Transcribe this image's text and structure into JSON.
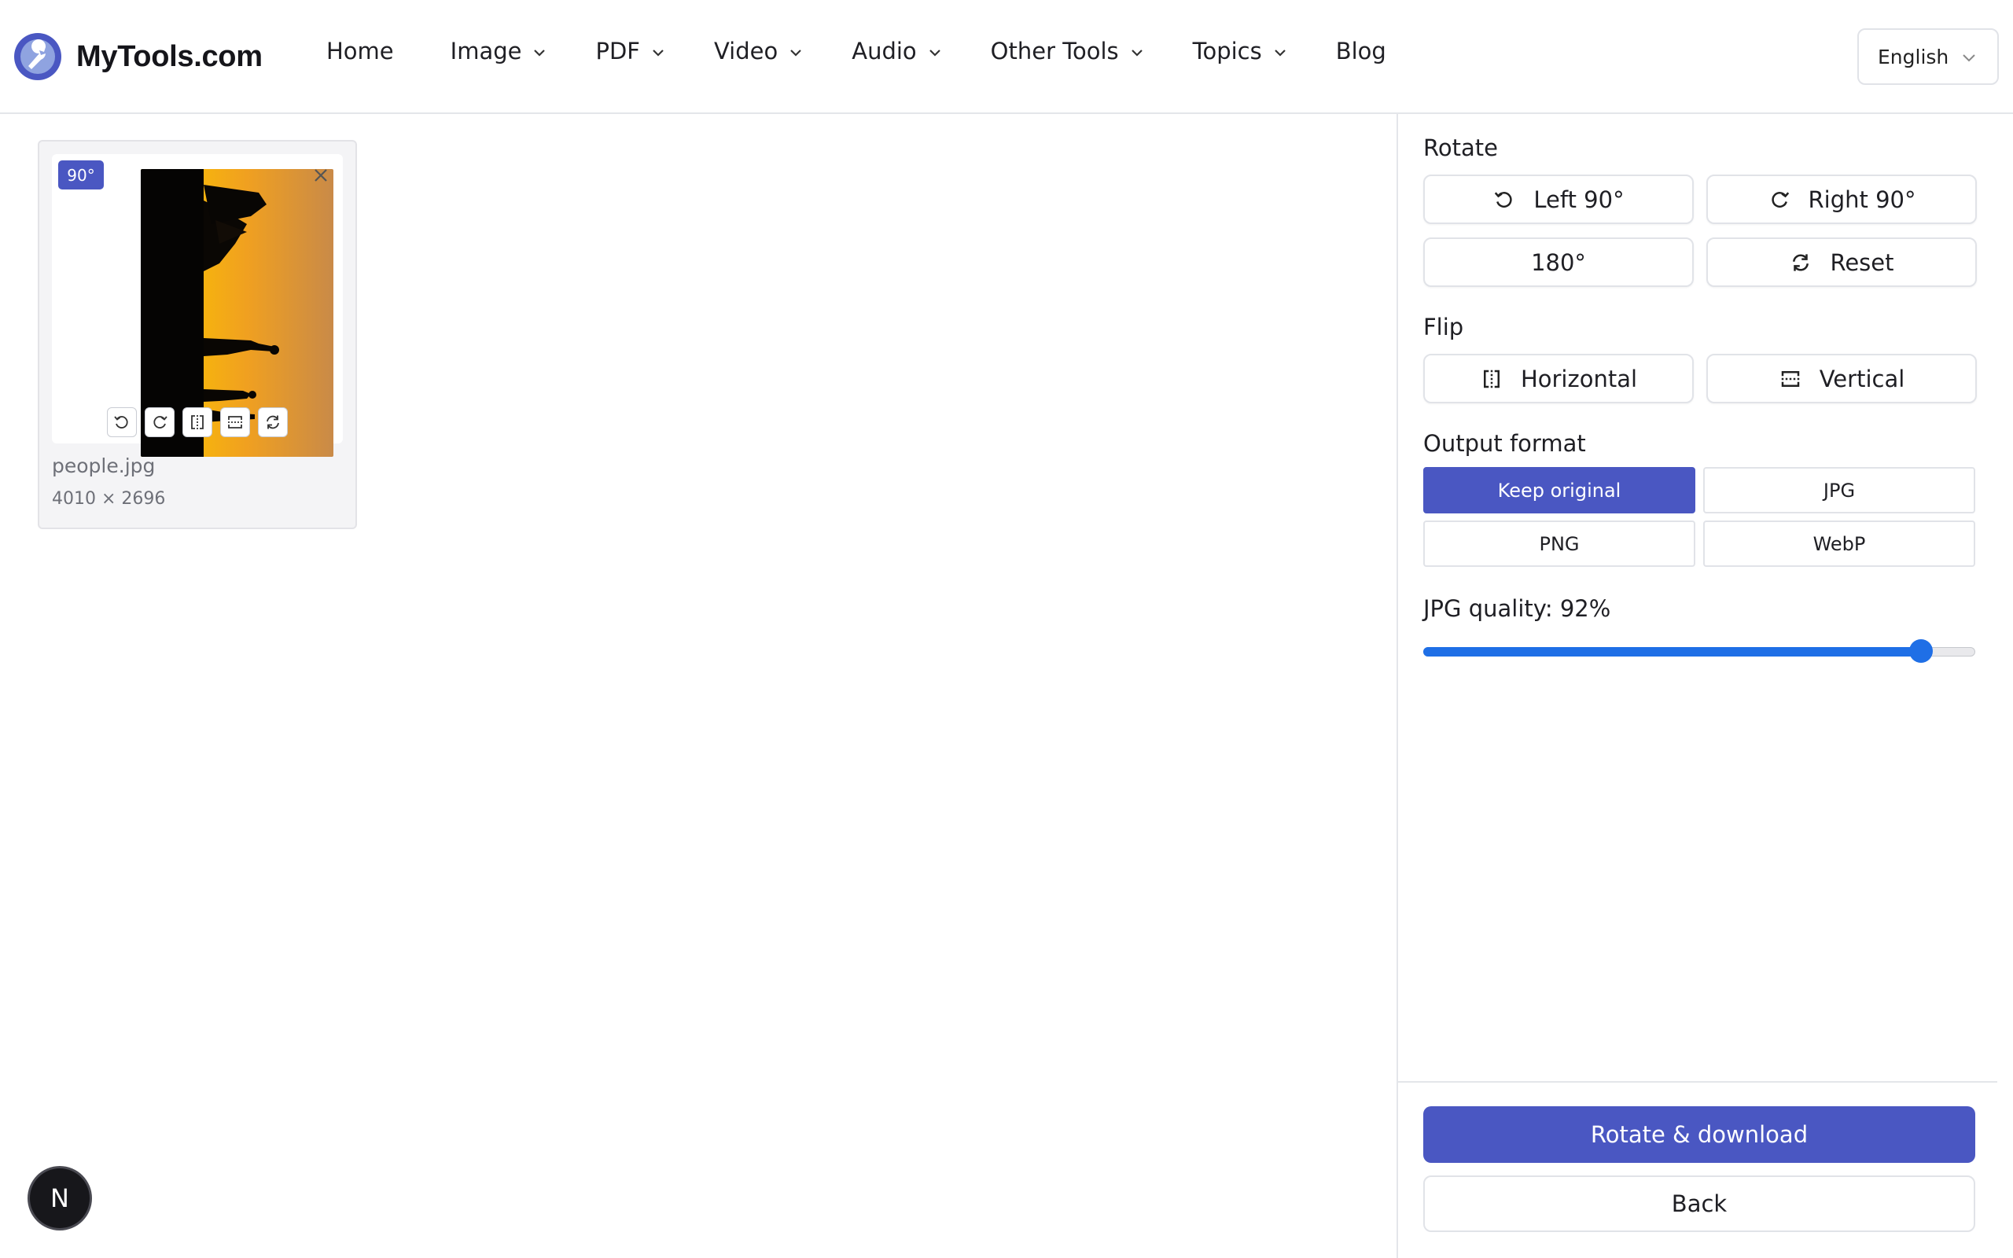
{
  "header": {
    "brand": "MyTools.com",
    "nav": [
      {
        "label": "Home"
      },
      {
        "label": "Image"
      },
      {
        "label": "PDF"
      },
      {
        "label": "Video"
      },
      {
        "label": "Audio"
      },
      {
        "label": "Other Tools"
      },
      {
        "label": "Topics"
      },
      {
        "label": "Blog"
      }
    ],
    "language": "English"
  },
  "file": {
    "rotation_badge": "90°",
    "name": "people.jpg",
    "dimensions": "4010 × 2696",
    "mini_tools": [
      "rotate-left-icon",
      "rotate-right-icon",
      "flip-horizontal-icon",
      "flip-vertical-icon",
      "reset-icon"
    ]
  },
  "panel": {
    "rotate_label": "Rotate",
    "left_label": "Left 90°",
    "right_label": "Right 90°",
    "r180_label": "180°",
    "reset_label": "Reset",
    "flip_label": "Flip",
    "horizontal_label": "Horizontal",
    "vertical_label": "Vertical",
    "output_label": "Output format",
    "formats": [
      "Keep original",
      "JPG",
      "PNG",
      "WebP"
    ],
    "selected_format": "Keep original",
    "quality_label": "JPG quality: 92%",
    "quality_value": 92,
    "download_label": "Rotate & download",
    "back_label": "Back"
  },
  "fab_label": "N",
  "colors": {
    "accent": "#4a57c2",
    "slider": "#1f6fe6"
  }
}
